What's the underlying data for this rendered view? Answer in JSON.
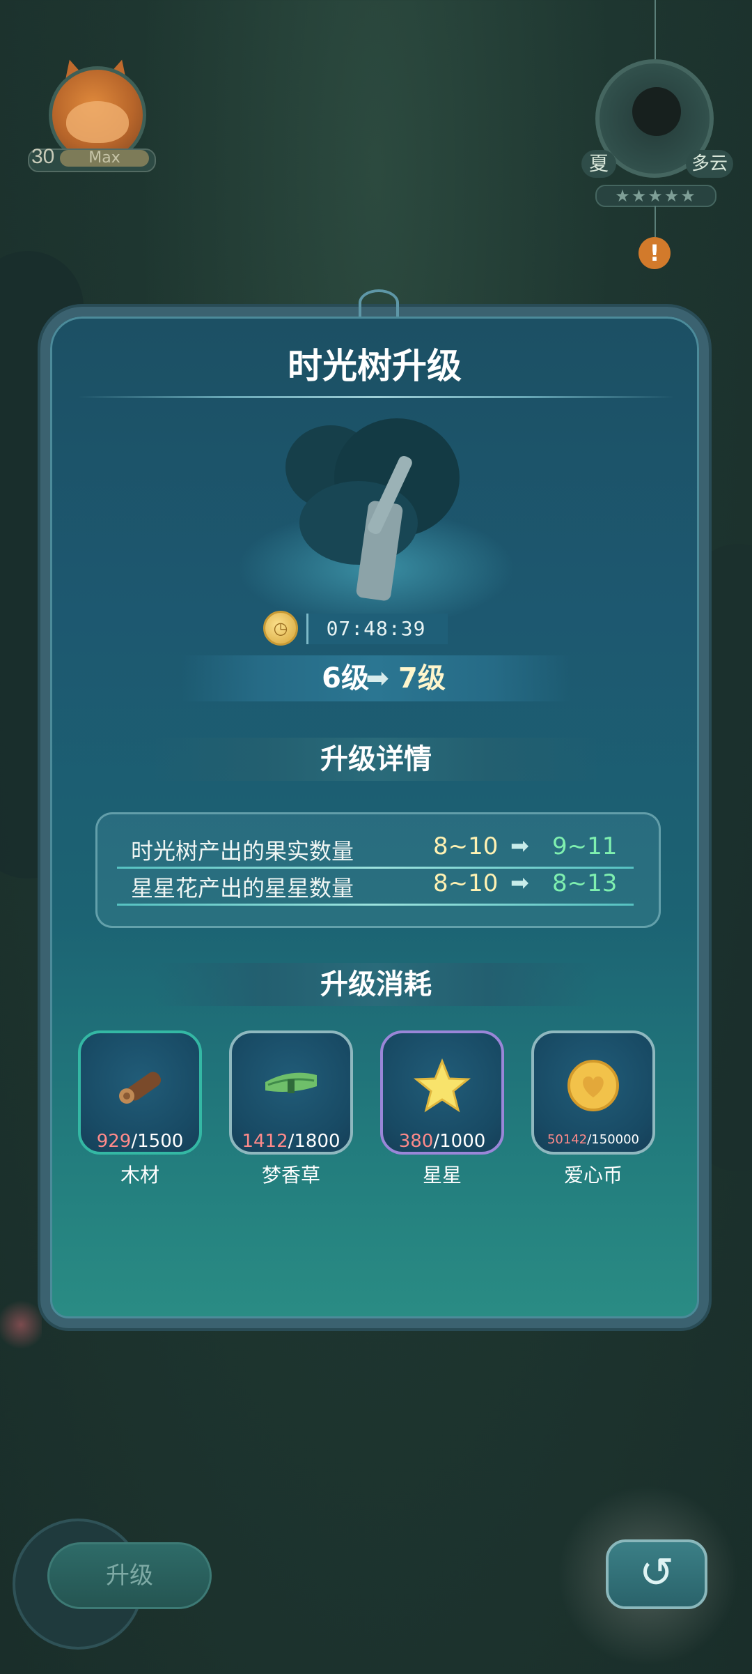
{
  "player": {
    "level": "30",
    "level_status": "Max"
  },
  "weather": {
    "season": "夏",
    "condition": "多云",
    "stars": "★★★★★",
    "alert_symbol": "!"
  },
  "panel": {
    "title": "时光树升级",
    "timer": "07:48:39",
    "level_from": "6级",
    "level_arrow": "➡",
    "level_to": "7级"
  },
  "details": {
    "title": "升级详情",
    "rows": [
      {
        "label": "时光树产出的果实数量",
        "from": "8~10",
        "arrow": "➡",
        "to": "9~11"
      },
      {
        "label": "星星花产出的星星数量",
        "from": "8~10",
        "arrow": "➡",
        "to": "8~13"
      }
    ]
  },
  "costs": {
    "title": "升级消耗",
    "items": [
      {
        "name": "木材",
        "have": "929",
        "need": "/1500",
        "icon": "wood-log-icon",
        "border": "#34b8a4"
      },
      {
        "name": "梦香草",
        "have": "1412",
        "need": "/1800",
        "icon": "grass-bundle-icon",
        "border": "#8fb8bf"
      },
      {
        "name": "星星",
        "have": "380",
        "need": "/1000",
        "icon": "star-icon",
        "border": "#9a86d8"
      },
      {
        "name": "爱心币",
        "have": "50142",
        "need": "/150000",
        "icon": "heart-coin-icon",
        "border": "#8fb8bf"
      }
    ]
  },
  "bottom": {
    "upgrade_label": "升级",
    "back_symbol": "↺"
  },
  "colors": {
    "have_red": "#ff8a8a",
    "increase_green": "#7ff0b0",
    "panel_blue": "#1d5870"
  }
}
